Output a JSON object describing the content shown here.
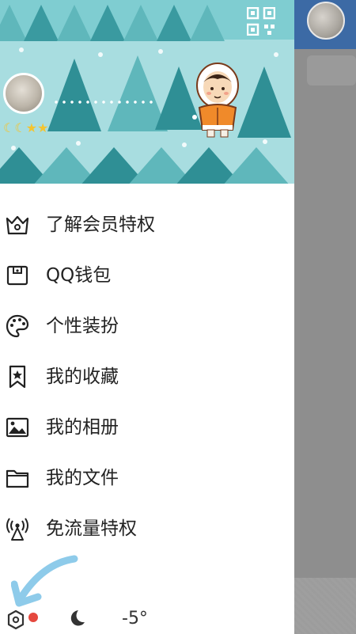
{
  "header": {
    "qr_icon": "qr-code-icon",
    "level_badges": "☾☾★★",
    "colors": {
      "sky": "#a8dde0",
      "tree_dark": "#2f8f95",
      "tree_light": "#5fb7bb",
      "snow": "#ffffff"
    }
  },
  "menu": {
    "items": [
      {
        "label": "了解会员特权",
        "icon": "crown-icon"
      },
      {
        "label": "QQ钱包",
        "icon": "wallet-icon"
      },
      {
        "label": "个性装扮",
        "icon": "palette-icon"
      },
      {
        "label": "我的收藏",
        "icon": "bookmark-star-icon"
      },
      {
        "label": "我的相册",
        "icon": "image-icon"
      },
      {
        "label": "我的文件",
        "icon": "folder-icon"
      },
      {
        "label": "免流量特权",
        "icon": "signal-tower-icon"
      }
    ]
  },
  "bottom": {
    "settings_icon": "settings-hexagon-icon",
    "night_icon": "moon-icon",
    "temperature": "-5°"
  },
  "colors": {
    "accent_red": "#e5483e",
    "annotation_arrow": "#8ecbea",
    "topbar_blue": "#3c6aa5",
    "overlay": "#8e8e8e"
  }
}
